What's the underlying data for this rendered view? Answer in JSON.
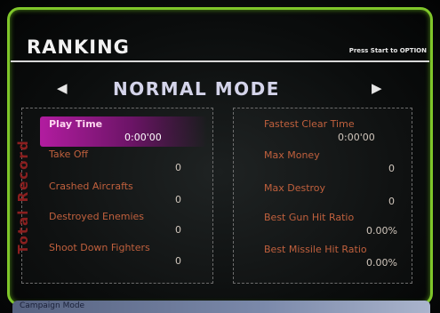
{
  "header": {
    "title": "RANKING",
    "hint": "Press Start to OPTION"
  },
  "mode": {
    "left_arrow": "◀",
    "right_arrow": "▶",
    "label": "NORMAL MODE"
  },
  "side_label": "Total Record",
  "left_stats": [
    {
      "label": "Play Time",
      "value": "0:00'00",
      "selected": true
    },
    {
      "label": "Take Off",
      "value": "0"
    },
    {
      "label": "Crashed Aircrafts",
      "value": "0"
    },
    {
      "label": "Destroyed Enemies",
      "value": "0"
    },
    {
      "label": "Shoot Down Fighters",
      "value": "0"
    }
  ],
  "right_stats": [
    {
      "label": "Fastest Clear Time",
      "value": "0:00'00"
    },
    {
      "label": "Max Money",
      "value": "0"
    },
    {
      "label": "Max Destroy",
      "value": "0"
    },
    {
      "label": "Best Gun Hit Ratio",
      "value": "0.00%"
    },
    {
      "label": "Best Missile Hit Ratio",
      "value": "0.00%"
    }
  ],
  "footer": {
    "text": "Campaign Mode"
  },
  "colors": {
    "frame": "#7fc62a",
    "highlight": "#b21ca0",
    "label": "#c0603d",
    "side": "#8a1f1f"
  }
}
